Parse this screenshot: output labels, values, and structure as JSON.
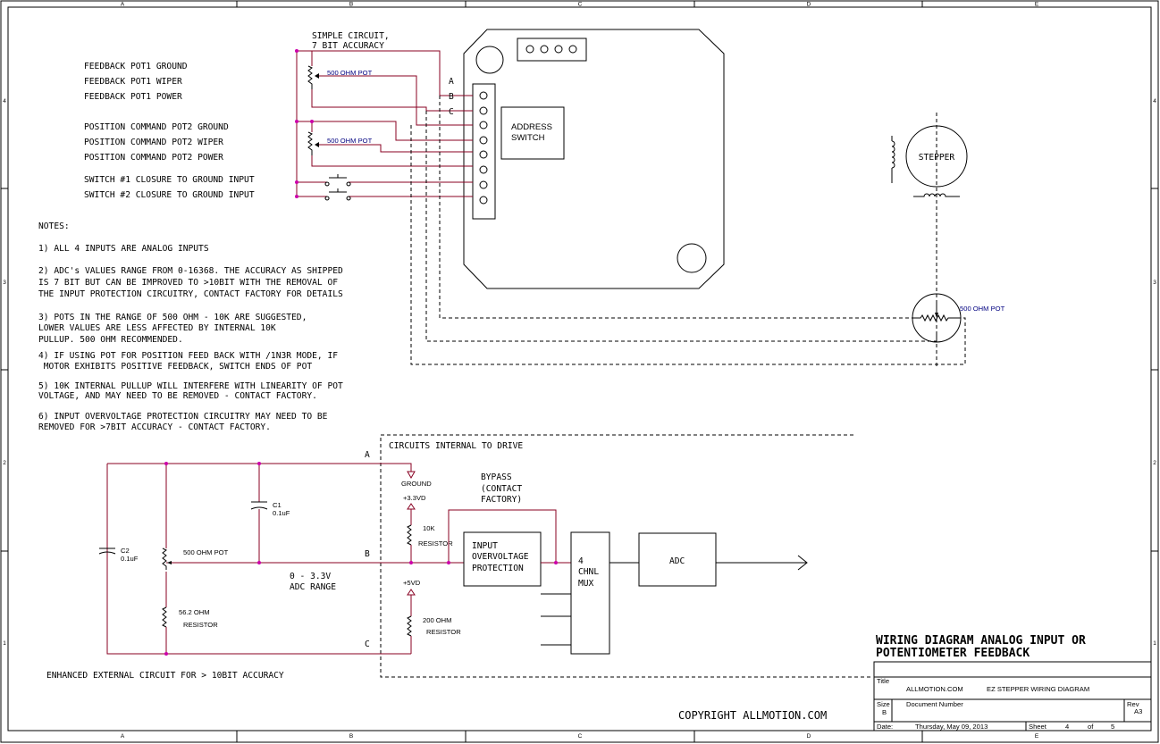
{
  "border": {
    "cols": [
      "A",
      "B",
      "C",
      "D",
      "E"
    ],
    "rows": [
      "4",
      "3",
      "2",
      "1"
    ]
  },
  "top_circuit": {
    "label_line1": "SIMPLE CIRCUIT,",
    "label_line2": "7 BIT ACCURACY",
    "pot1_label": "500 OHM POT",
    "pot2_label": "500 OHM POT",
    "wire_a": "A",
    "wire_b": "B",
    "wire_c": "C",
    "inputs": [
      "FEEDBACK POT1 GROUND",
      "FEEDBACK POT1 WIPER",
      "FEEDBACK POT1 POWER",
      "POSITION COMMAND POT2 GROUND",
      "POSITION COMMAND POT2 WIPER",
      "POSITION COMMAND POT2 POWER",
      "SWITCH #1 CLOSURE TO GROUND INPUT",
      "SWITCH #2 CLOSURE TO GROUND INPUT"
    ],
    "address_switch_line1": "ADDRESS",
    "address_switch_line2": "SWITCH"
  },
  "stepper": {
    "label": "STEPPER",
    "pot_label": "500 OHM POT"
  },
  "notes": {
    "heading": "NOTES:",
    "lines": [
      "1) ALL 4 INPUTS ARE ANALOG INPUTS",
      "2) ADC's VALUES RANGE FROM 0-16368. THE ACCURACY AS SHIPPED",
      "IS 7 BIT BUT CAN BE IMPROVED TO >10BIT WITH THE REMOVAL OF",
      "THE INPUT PROTECTION CIRCUITRY, CONTACT FACTORY FOR DETAILS",
      "3) POTS IN THE RANGE OF 500 OHM - 10K ARE SUGGESTED,",
      "LOWER VALUES ARE LESS AFFECTED BY INTERNAL 10K",
      "PULLUP. 500 OHM RECOMMENDED.",
      "4) IF USING POT FOR POSITION FEED BACK WITH /1N3R MODE, IF",
      " MOTOR EXHIBITS POSITIVE FEEDBACK, SWITCH ENDS OF POT",
      "5) 10K INTERNAL PULLUP WILL INTERFERE WITH LINEARITY OF POT",
      "VOLTAGE, AND MAY NEED TO BE REMOVED - CONTACT FACTORY.",
      "6) INPUT OVERVOLTAGE PROTECTION CIRCUITRY MAY NEED TO BE",
      "REMOVED FOR >7BIT ACCURACY - CONTACT FACTORY."
    ]
  },
  "bottom_circuit": {
    "internal_label": "CIRCUITS INTERNAL TO DRIVE",
    "node_a": "A",
    "node_b": "B",
    "node_c": "C",
    "c2_name": "C2",
    "c2_value": "0.1uF",
    "c1_name": "C1",
    "c1_value": "0.1uF",
    "pot_label": "500 OHM POT",
    "r_ohm": "56.2 OHM",
    "r_label": "RESISTOR",
    "adc_range_1": "0 - 3.3V",
    "adc_range_2": "ADC RANGE",
    "ground": "GROUND",
    "v33": "+3.3VD",
    "r10k": "10K",
    "r10k_label": "RESISTOR",
    "v5": "+5VD",
    "r200": "200 OHM",
    "r200_label": "RESISTOR",
    "bypass_1": "BYPASS",
    "bypass_2": "(CONTACT",
    "bypass_3": "FACTORY)",
    "protection_1": "INPUT",
    "protection_2": "OVERVOLTAGE",
    "protection_3": "PROTECTION",
    "mux_1": "4",
    "mux_2": "CHNL",
    "mux_3": "MUX",
    "adc": "ADC",
    "enhanced_label": "ENHANCED EXTERNAL CIRCUIT FOR > 10BIT ACCURACY"
  },
  "title_block": {
    "title_line1": "WIRING DIAGRAM ANALOG INPUT OR",
    "title_line2": "POTENTIOMETER FEEDBACK",
    "title_caption": "Title",
    "company": "ALLMOTION.COM",
    "diagram_name": "EZ STEPPER WIRING DIAGRAM",
    "size_caption": "Size",
    "size": "B",
    "docnum_caption": "Document Number",
    "rev_caption": "Rev",
    "rev": "A3",
    "date_caption": "Date:",
    "date": "Thursday, May 09, 2013",
    "sheet_caption": "Sheet",
    "sheet": "4",
    "of_caption": "of",
    "of": "5",
    "copyright": "COPYRIGHT ALLMOTION.COM"
  }
}
